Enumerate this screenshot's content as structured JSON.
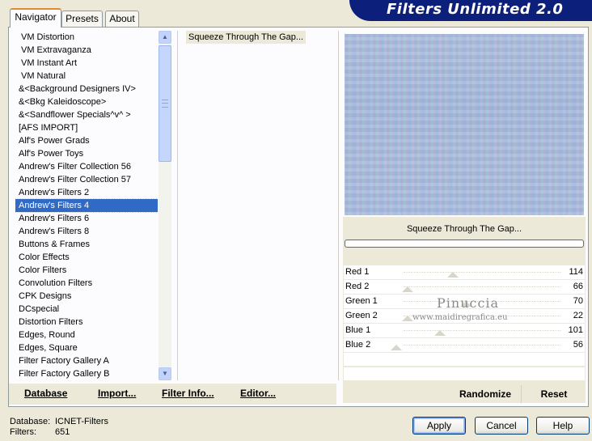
{
  "app": {
    "title": "Filters Unlimited 2.0"
  },
  "tabs": [
    {
      "label": "Navigator"
    },
    {
      "label": "Presets"
    },
    {
      "label": "About"
    }
  ],
  "categories": {
    "selected": "Andrew's Filters 4",
    "items": [
      "VM Distortion",
      "VM Extravaganza",
      "VM Instant Art",
      "VM Natural",
      "&<Background Designers IV>",
      "&<Bkg Kaleidoscope>",
      "&<Sandflower Specials^v^ >",
      "[AFS IMPORT]",
      "Alf's Power Grads",
      "Alf's Power Toys",
      "Andrew's Filter Collection 56",
      "Andrew's Filter Collection 57",
      "Andrew's Filters 2",
      "Andrew's Filters 4",
      "Andrew's Filters 6",
      "Andrew's Filters 8",
      "Buttons & Frames",
      "Color Effects",
      "Color Filters",
      "Convolution Filters",
      "CPK Designs",
      "DCspecial",
      "Distortion Filters",
      "Edges, Round",
      "Edges, Square",
      "Filter Factory Gallery A",
      "Filter Factory Gallery B"
    ]
  },
  "filters": {
    "items": [
      "Squeeze Through The Gap..."
    ]
  },
  "bottom_links": {
    "database": "Database",
    "import": "Import...",
    "filter_info": "Filter Info...",
    "editor": "Editor..."
  },
  "preview": {
    "filter_name": "Squeeze Through The Gap...",
    "progress": 0
  },
  "sliders": [
    {
      "label": "Red 1",
      "value": "114"
    },
    {
      "label": "Red 2",
      "value": "66"
    },
    {
      "label": "Green 1",
      "value": "70"
    },
    {
      "label": "Green 2",
      "value": "22"
    },
    {
      "label": "Blue 1",
      "value": "101"
    },
    {
      "label": "Blue 2",
      "value": "56"
    }
  ],
  "watermark": {
    "name": "Pinuccia",
    "url": "www.maidiregrafica.eu"
  },
  "right_buttons": {
    "randomize": "Randomize",
    "reset": "Reset"
  },
  "status": {
    "database_label": "Database:",
    "database_value": "ICNET-Filters",
    "filters_label": "Filters:",
    "filters_value": "651"
  },
  "dialog_buttons": {
    "apply": "Apply",
    "cancel": "Cancel",
    "help": "Help"
  }
}
